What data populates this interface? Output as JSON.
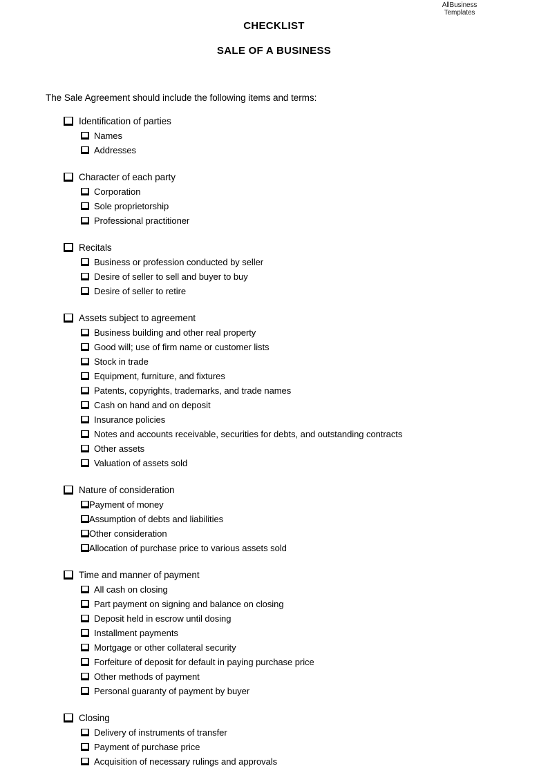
{
  "logo": {
    "line1": "AllBusiness",
    "line2": "Templates"
  },
  "header": {
    "title": "CHECKLIST",
    "subtitle": "SALE OF A BUSINESS"
  },
  "body": {
    "intro": "The Sale Agreement should include the following items and terms:"
  },
  "sections": [
    {
      "heading": "Identification of parties",
      "tight": false,
      "items": [
        "Names",
        "Addresses"
      ]
    },
    {
      "heading": "Character of each party",
      "tight": false,
      "items": [
        "Corporation",
        "Sole proprietorship",
        "Professional practitioner"
      ]
    },
    {
      "heading": "Recitals",
      "tight": false,
      "items": [
        "Business or profession conducted by seller",
        "Desire of seller to sell and buyer to buy",
        "Desire of seller to retire"
      ]
    },
    {
      "heading": "Assets subject to agreement",
      "tight": false,
      "items": [
        "Business building and other real property",
        "Good will; use of firm name or customer lists",
        "Stock in trade",
        "Equipment, furniture, and fixtures",
        "Patents, copyrights, trademarks, and trade names",
        "Cash on hand and on deposit",
        "Insurance policies",
        "Notes and accounts receivable, securities for debts, and outstanding contracts",
        "Other assets",
        "Valuation of assets sold"
      ]
    },
    {
      "heading": "Nature of consideration",
      "tight": true,
      "items": [
        "Payment of money",
        "Assumption of debts and liabilities",
        "Other consideration",
        "Allocation of purchase price to various assets sold"
      ]
    },
    {
      "heading": "Time and manner of payment",
      "tight": false,
      "items": [
        "All cash on closing",
        "Part payment on signing and balance on closing",
        "Deposit held in escrow until dosing",
        "Installment payments",
        "Mortgage or other collateral security",
        "Forfeiture of deposit for default in paying purchase price",
        "Other methods of payment",
        "Personal guaranty of payment by buyer"
      ]
    },
    {
      "heading": "Closing",
      "tight": false,
      "items": [
        "Delivery of instruments of transfer",
        "Payment of purchase price",
        "Acquisition of necessary rulings and approvals"
      ]
    }
  ]
}
